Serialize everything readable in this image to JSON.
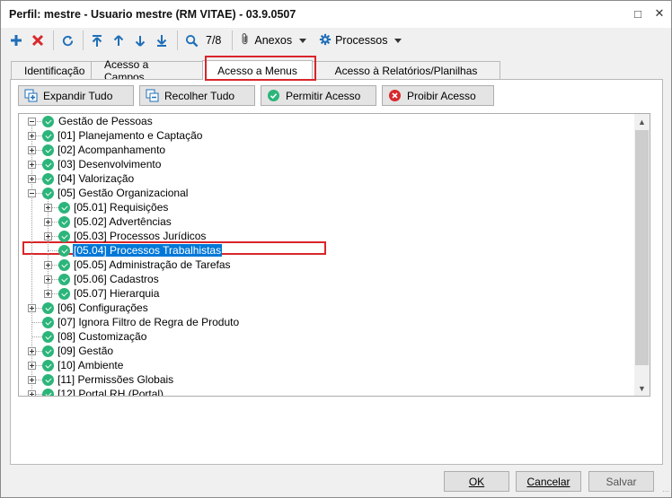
{
  "window": {
    "title": "Perfil: mestre - Usuario mestre (RM VITAE) - 03.9.0507",
    "restore_glyph": "□",
    "close_glyph": "✕"
  },
  "toolbar": {
    "record_position": "7/8",
    "attachments_label": "Anexos",
    "processes_label": "Processos",
    "icons": [
      "add-icon",
      "delete-icon",
      "refresh-icon",
      "first-record-icon",
      "previous-record-icon",
      "next-record-icon",
      "last-record-icon",
      "search-icon",
      "paperclip-icon",
      "gear-icon"
    ]
  },
  "tabs": [
    {
      "label": "Identificação",
      "active": false
    },
    {
      "label": "Acesso a Campos",
      "active": false
    },
    {
      "label": "Acesso a Menus",
      "active": true
    },
    {
      "label": "Acesso à Relatórios/Planilhas",
      "active": false
    }
  ],
  "actions": {
    "expand_all": "Expandir Tudo",
    "collapse_all": "Recolher Tudo",
    "allow_access": "Permitir Acesso",
    "deny_access": "Proibir Acesso"
  },
  "tree": {
    "root": "Gestão de Pessoas",
    "items": [
      {
        "label": "[01] Planejamento e Captação",
        "level": 1,
        "expander": "plus",
        "checked": true
      },
      {
        "label": "[02] Acompanhamento",
        "level": 1,
        "expander": "plus",
        "checked": true
      },
      {
        "label": "[03] Desenvolvimento",
        "level": 1,
        "expander": "plus",
        "checked": true
      },
      {
        "label": "[04] Valorização",
        "level": 1,
        "expander": "plus",
        "checked": true
      },
      {
        "label": "[05] Gestão Organizacional",
        "level": 1,
        "expander": "minus",
        "checked": true
      },
      {
        "label": "[05.01] Requisições",
        "level": 2,
        "expander": "plus",
        "checked": true
      },
      {
        "label": "[05.02] Advertências",
        "level": 2,
        "expander": "plus",
        "checked": true
      },
      {
        "label": "[05.03] Processos Jurídicos",
        "level": 2,
        "expander": "plus",
        "checked": true
      },
      {
        "label": "[05.04] Processos Trabalhistas",
        "level": 2,
        "expander": "none",
        "checked": true,
        "selected": true
      },
      {
        "label": "[05.05] Administração de Tarefas",
        "level": 2,
        "expander": "plus",
        "checked": true
      },
      {
        "label": "[05.06] Cadastros",
        "level": 2,
        "expander": "plus",
        "checked": true
      },
      {
        "label": "[05.07] Hierarquia",
        "level": 2,
        "expander": "plus",
        "checked": true
      },
      {
        "label": "[06] Configurações",
        "level": 1,
        "expander": "plus",
        "checked": true
      },
      {
        "label": "[07] Ignora Filtro de Regra de Produto",
        "level": 1,
        "expander": "none",
        "checked": true
      },
      {
        "label": "[08] Customização",
        "level": 1,
        "expander": "none",
        "checked": true
      },
      {
        "label": "[09] Gestão",
        "level": 1,
        "expander": "plus",
        "checked": true
      },
      {
        "label": "[10] Ambiente",
        "level": 1,
        "expander": "plus",
        "checked": true
      },
      {
        "label": "[11] Permissões Globais",
        "level": 1,
        "expander": "plus",
        "checked": true
      },
      {
        "label": "[12] Portal RH (Portal)",
        "level": 1,
        "expander": "plus",
        "checked": true
      }
    ]
  },
  "footer": {
    "ok": "OK",
    "cancel": "Cancelar",
    "save": "Salvar"
  },
  "colors": {
    "check_green": "#2bb57a",
    "selection_blue": "#0078d7",
    "highlight_red": "#d9252a",
    "delete_red": "#d8282c",
    "tool_blue": "#1f6fb8"
  }
}
